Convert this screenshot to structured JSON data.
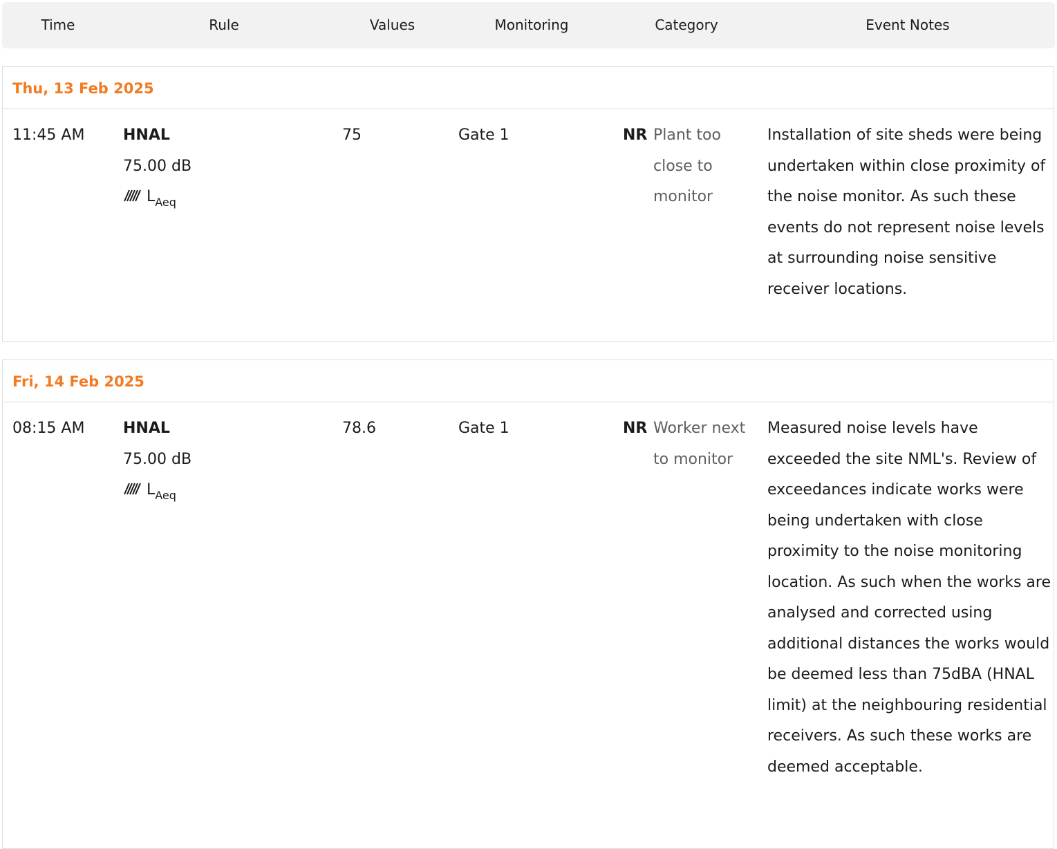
{
  "header": {
    "columns": [
      "Time",
      "Rule",
      "Values",
      "Monitoring",
      "Category",
      "Event Notes"
    ]
  },
  "groups": [
    {
      "date": "Thu, 13 Feb 2025",
      "event": {
        "time": "11:45 AM",
        "rule_name": "HNAL",
        "rule_limit": "75.00 dB",
        "metric_main": "L",
        "metric_sub": "Aeq",
        "metric_icon": "hatched-noise-icon",
        "value": "75",
        "monitoring": "Gate 1",
        "category_code": "NR",
        "category_text": "Plant too close to monitor",
        "notes": "Installation of site sheds were being undertaken within close proximity of the noise monitor. As such these events do not represent noise levels at surrounding noise sensitive receiver locations."
      }
    },
    {
      "date": "Fri, 14 Feb 2025",
      "event": {
        "time": "08:15 AM",
        "rule_name": "HNAL",
        "rule_limit": "75.00 dB",
        "metric_main": "L",
        "metric_sub": "Aeq",
        "metric_icon": "hatched-noise-icon",
        "value": "78.6",
        "monitoring": "Gate 1",
        "category_code": "NR",
        "category_text": "Worker next to monitor",
        "notes": "Measured noise levels have exceeded the site NML's. Review of exceedances indicate works were being undertaken with close proximity to the noise monitoring location. As such when the works are analysed and corrected using additional distances the works would be deemed less than 75dBA (HNAL limit) at the neighbouring residential receivers. As such these works are deemed acceptable."
      }
    }
  ],
  "colors": {
    "date_accent": "#f47a20",
    "header_bg": "#f2f2f2",
    "border": "#dcdcdc",
    "category_text": "#5f5f5f"
  }
}
